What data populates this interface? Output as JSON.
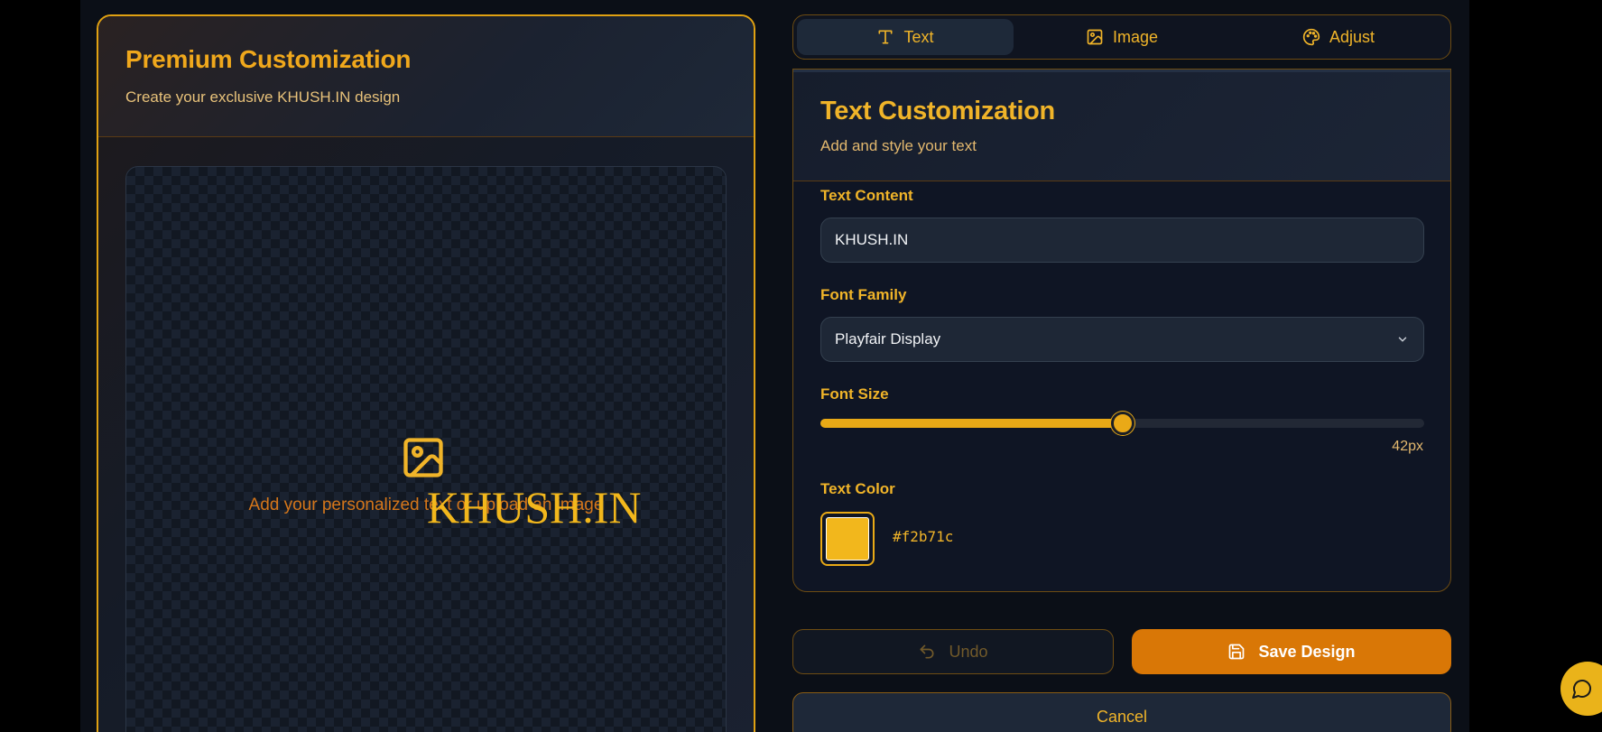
{
  "left_card": {
    "title": "Premium Customization",
    "subtitle": "Create your exclusive KHUSH.IN design",
    "canvas_hint": "Add your personalized text or upload an image",
    "canvas_icon": "image-icon",
    "preview_text": "KHUSH.IN"
  },
  "tabs": [
    {
      "label": "Text",
      "icon": "text-icon",
      "active": true
    },
    {
      "label": "Image",
      "icon": "image-icon",
      "active": false
    },
    {
      "label": "Adjust",
      "icon": "palette-icon",
      "active": false
    }
  ],
  "panel": {
    "title": "Text Customization",
    "subtitle": "Add and style your text",
    "text_content_label": "Text Content",
    "text_content_value": "KHUSH.IN",
    "font_family_label": "Font Family",
    "font_family_value": "Playfair Display",
    "font_size_label": "Font Size",
    "font_size_value": "42px",
    "font_size_fraction": 0.5,
    "text_color_label": "Text Color",
    "text_color_hex": "#f2b71c"
  },
  "buttons": {
    "undo": "Undo",
    "save": "Save Design",
    "cancel": "Cancel"
  },
  "colors": {
    "accent": "#f0b429",
    "primary_button": "#d97706",
    "background": "#0b0f17"
  }
}
